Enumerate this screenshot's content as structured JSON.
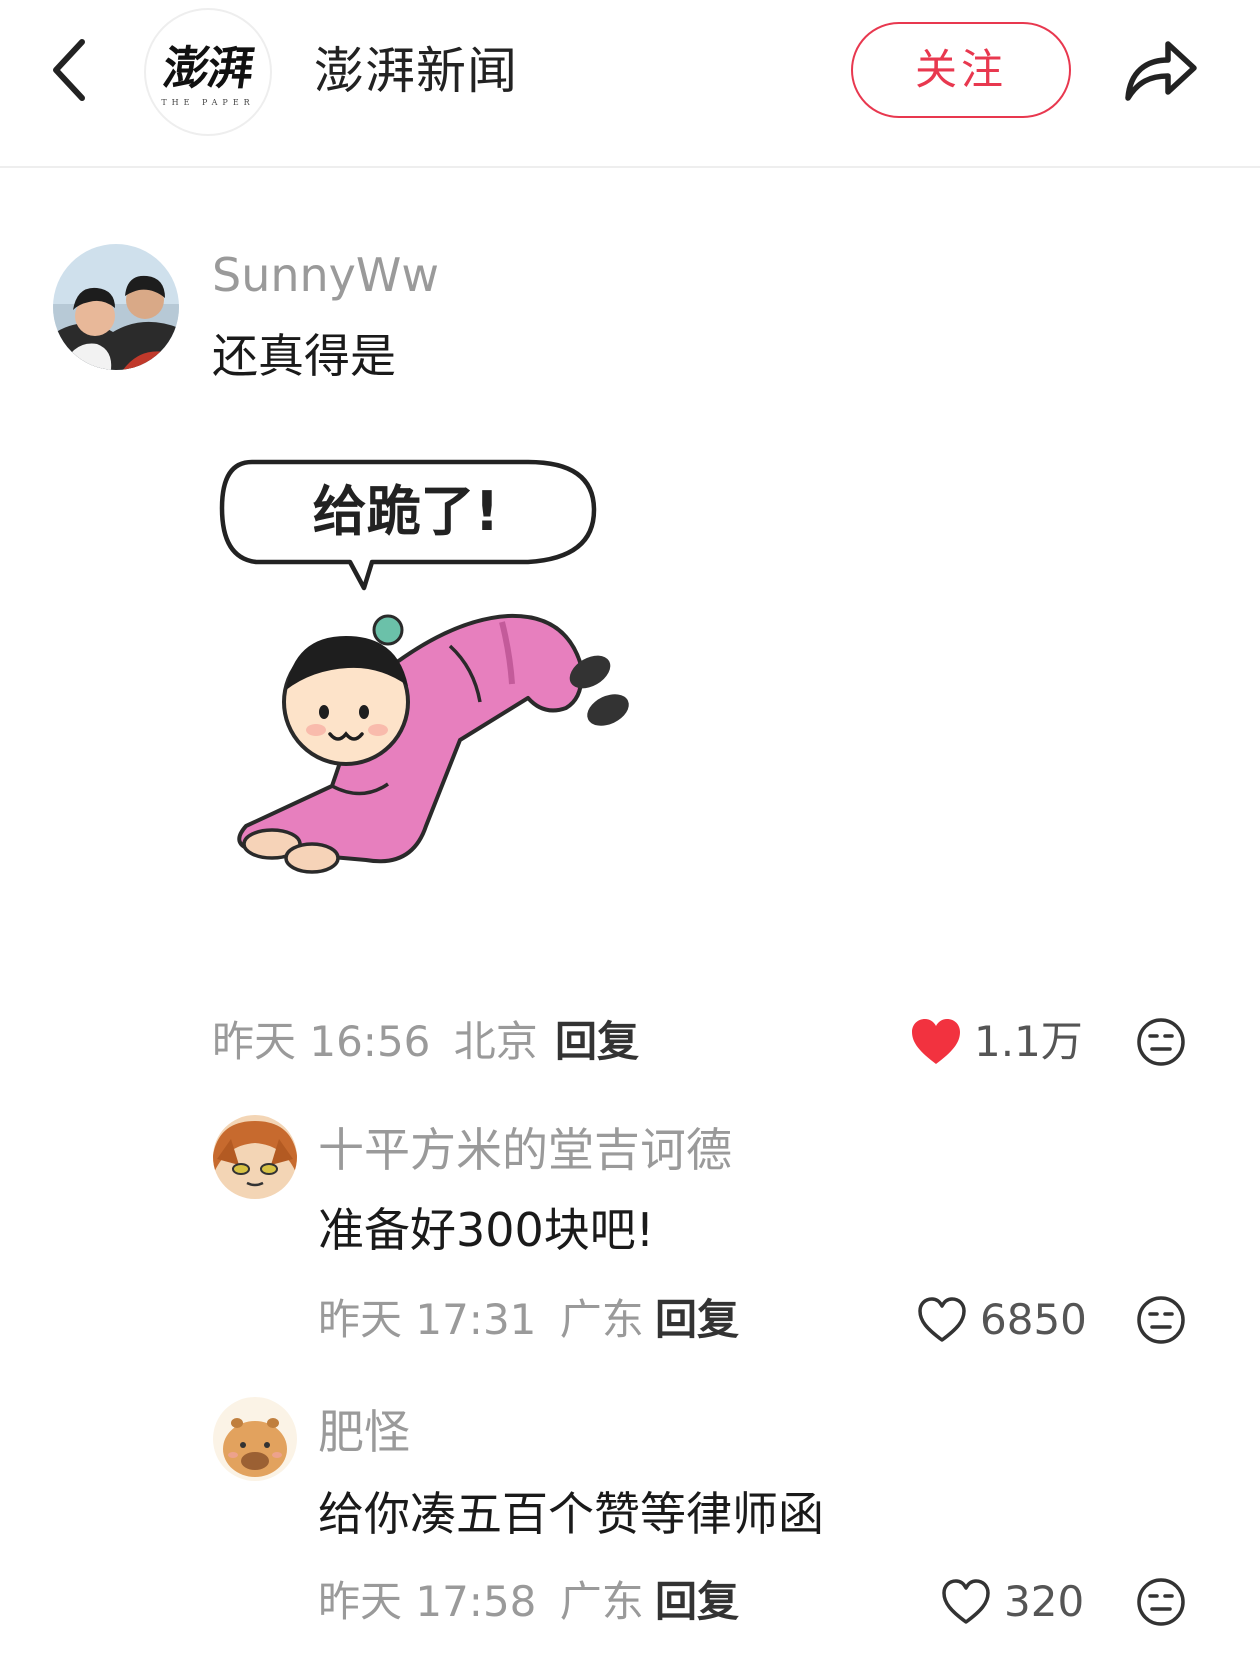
{
  "header": {
    "channel_name": "澎湃新闻",
    "logo_text": "澎湃",
    "logo_subtext": "THE PAPER",
    "follow_label": "关注",
    "accent_color": "#e8384f"
  },
  "comments": [
    {
      "username": "SunnyWw",
      "text": "还真得是",
      "sticker_text": "给跪了!",
      "time": "昨天 16:56",
      "location": "北京",
      "reply_label": "回复",
      "likes": "1.1万",
      "liked": true,
      "like_icon": "heart-filled-icon",
      "dislike_icon": "dislike-face-icon"
    },
    {
      "username": "十平方米的堂吉诃德",
      "text": "准备好300块吧!",
      "time": "昨天 17:31",
      "location": "广东",
      "reply_label": "回复",
      "likes": "6850",
      "liked": false,
      "like_icon": "heart-outline-icon",
      "dislike_icon": "dislike-face-icon"
    },
    {
      "username": "肥怪",
      "text": "给你凑五百个赞等律师函",
      "time": "昨天 17:58",
      "location": "广东",
      "reply_label": "回复",
      "likes": "320",
      "liked": false,
      "like_icon": "heart-outline-icon",
      "dislike_icon": "dislike-face-icon"
    }
  ]
}
